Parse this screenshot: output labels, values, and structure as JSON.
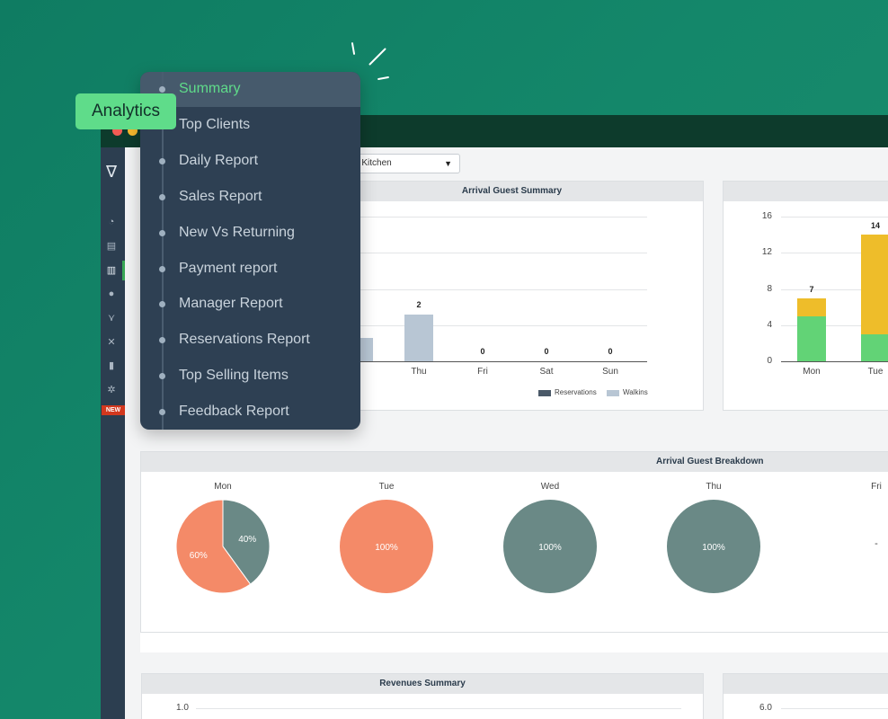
{
  "analytics_tag": "Analytics",
  "menu": {
    "items": [
      {
        "label": "Summary",
        "active": true
      },
      {
        "label": "Top Clients"
      },
      {
        "label": "Daily Report"
      },
      {
        "label": "Sales Report"
      },
      {
        "label": "New Vs Returning"
      },
      {
        "label": "Payment report"
      },
      {
        "label": "Manager Report"
      },
      {
        "label": "Reservations Report"
      },
      {
        "label": "Top Selling Items"
      },
      {
        "label": "Feedback Report"
      }
    ]
  },
  "rail": {
    "icons": [
      "logo-icon",
      "dashboard-icon",
      "reservations-icon",
      "analytics-icon",
      "user-icon",
      "share-icon",
      "tools-icon",
      "document-icon",
      "gear-icon"
    ],
    "new_badge": "NEW"
  },
  "location_select": {
    "value": "erhouz Kitchen",
    "caret": "▼"
  },
  "colors": {
    "reservations": "#4a5968",
    "walkins": "#b8c6d4",
    "yellow": "#eebd2a",
    "green": "#62d376",
    "salmon": "#f48a68",
    "slate": "#6a8986"
  },
  "arrival_summary": {
    "title": "Arrival Guest Summary",
    "legend": [
      "Reservations",
      "Walkins"
    ],
    "chart_data": {
      "type": "bar",
      "categories": [
        "ed",
        "Thu",
        "Fri",
        "Sat",
        "Sun"
      ],
      "series": [
        {
          "name": "Reservations",
          "values": [
            null,
            0,
            0,
            0,
            0
          ]
        },
        {
          "name": "Walkins",
          "values": [
            null,
            2,
            0,
            0,
            0
          ]
        }
      ],
      "value_labels": [
        "",
        "2",
        "0",
        "0",
        "0"
      ]
    }
  },
  "stacked_chart": {
    "title": "",
    "chart_data": {
      "type": "bar",
      "categories": [
        "Mon",
        "Tue"
      ],
      "series": [
        {
          "values": [
            5,
            3
          ]
        },
        {
          "values": [
            2,
            11
          ]
        }
      ],
      "totals": [
        "7",
        "14"
      ],
      "yticks": [
        "16",
        "12",
        "8",
        "4",
        "0"
      ],
      "ylim": [
        0,
        16
      ]
    }
  },
  "breakdown": {
    "title": "Arrival Guest Breakdown",
    "days": [
      "Mon",
      "Tue",
      "Wed",
      "Thu",
      "Fri"
    ],
    "pies": [
      {
        "slices": [
          {
            "label": "40%",
            "value": 40,
            "color": "slate"
          },
          {
            "label": "60%",
            "value": 60,
            "color": "salmon"
          }
        ]
      },
      {
        "slices": [
          {
            "label": "100%",
            "value": 100,
            "color": "salmon"
          }
        ]
      },
      {
        "slices": [
          {
            "label": "100%",
            "value": 100,
            "color": "slate"
          }
        ]
      },
      {
        "slices": [
          {
            "label": "100%",
            "value": 100,
            "color": "slate"
          }
        ]
      },
      {
        "empty_label": "-"
      }
    ]
  },
  "revenues": {
    "title": "Revenues Summary",
    "ytick_top": "1.0"
  },
  "right_bottom": {
    "ytick_top": "6.0"
  }
}
